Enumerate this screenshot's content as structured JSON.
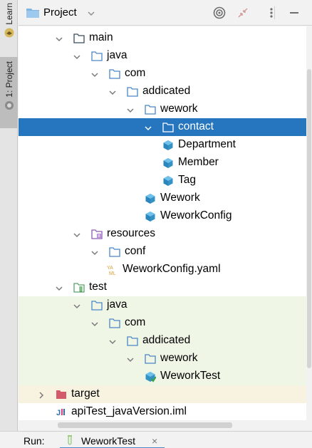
{
  "sidebar": {
    "learn_label": "Learn",
    "project_label": "1: Project"
  },
  "header": {
    "title": "Project"
  },
  "tree": [
    {
      "label": "main",
      "depth": 0,
      "state": "open",
      "icon": "folder-icon"
    },
    {
      "label": "java",
      "depth": 1,
      "state": "open",
      "icon": "source-folder-icon"
    },
    {
      "label": "com",
      "depth": 2,
      "state": "open",
      "icon": "package-icon"
    },
    {
      "label": "addicated",
      "depth": 3,
      "state": "open",
      "icon": "package-icon"
    },
    {
      "label": "wework",
      "depth": 4,
      "state": "open",
      "icon": "package-icon"
    },
    {
      "label": "contact",
      "depth": 5,
      "state": "open",
      "icon": "package-icon",
      "selected": true
    },
    {
      "label": "Department",
      "depth": 6,
      "state": "leaf",
      "icon": "class-icon"
    },
    {
      "label": "Member",
      "depth": 6,
      "state": "leaf",
      "icon": "class-icon"
    },
    {
      "label": "Tag",
      "depth": 6,
      "state": "leaf",
      "icon": "class-icon"
    },
    {
      "label": "Wework",
      "depth": 5,
      "state": "leaf",
      "icon": "class-icon"
    },
    {
      "label": "WeworkConfig",
      "depth": 5,
      "state": "leaf",
      "icon": "class-icon"
    },
    {
      "label": "resources",
      "depth": 1,
      "state": "open",
      "icon": "resources-folder-icon"
    },
    {
      "label": "conf",
      "depth": 2,
      "state": "open",
      "icon": "package-icon"
    },
    {
      "label": "WeworkConfig.yaml",
      "depth": 3,
      "state": "leaf",
      "icon": "yaml-file-icon"
    },
    {
      "label": "test",
      "depth": 0,
      "state": "open",
      "icon": "test-folder-icon"
    },
    {
      "label": "java",
      "depth": 1,
      "state": "open",
      "icon": "test-source-folder-icon",
      "bg": "test"
    },
    {
      "label": "com",
      "depth": 2,
      "state": "open",
      "icon": "package-icon",
      "bg": "test"
    },
    {
      "label": "addicated",
      "depth": 3,
      "state": "open",
      "icon": "package-icon",
      "bg": "test"
    },
    {
      "label": "wework",
      "depth": 4,
      "state": "open",
      "icon": "package-icon",
      "bg": "test"
    },
    {
      "label": "WeworkTest",
      "depth": 5,
      "state": "leaf",
      "icon": "test-class-icon",
      "bg": "test"
    },
    {
      "label": "target",
      "depth": -1,
      "state": "closed",
      "icon": "excluded-folder-icon",
      "bg": "target"
    },
    {
      "label": "apiTest_javaVersion.iml",
      "depth": -1,
      "state": "leaf",
      "icon": "iml-file-icon"
    }
  ],
  "run": {
    "label": "Run:",
    "config_name": "WeworkTest",
    "close_glyph": "×"
  },
  "colors": {
    "selection": "#2675bf",
    "test_bg": "#eff6e6",
    "target_bg": "#f7f3e0",
    "class_icon": "#3592c4",
    "folder_outline": "#4a86c7"
  }
}
